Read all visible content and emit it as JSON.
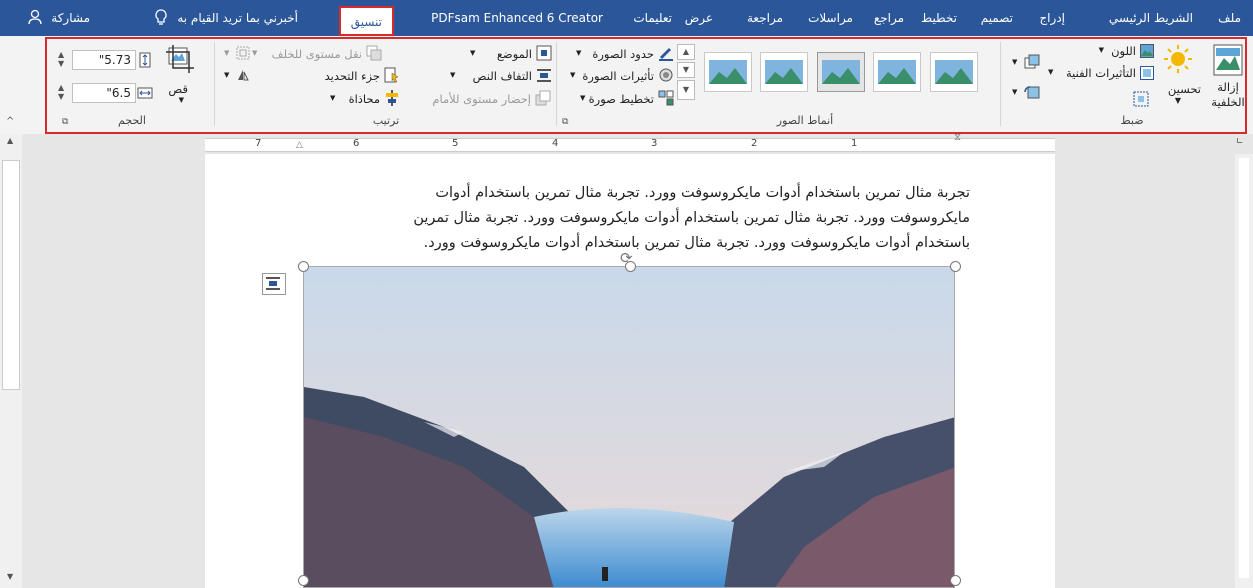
{
  "tabs": {
    "file": "ملف",
    "home": "الشريط الرئيسي",
    "insert": "إدراج",
    "design": "تصميم",
    "layout": "تخطيط",
    "references": "مراجع",
    "mailings": "مراسلات",
    "review": "مراجعة",
    "view": "عرض",
    "help": "تعليمات",
    "pdfsam": "PDFsam Enhanced 6 Creator",
    "format": "تنسيق",
    "tell_me": "أخبرني بما تريد القيام به",
    "share": "مشاركة"
  },
  "adjust": {
    "remove_bg": "إزالة الخلفية",
    "corrections": "تحسين",
    "color": "اللون",
    "artistic": "التأثيرات الفنية",
    "group_label": "ضبط"
  },
  "picture_styles": {
    "border": "حدود الصورة",
    "effects": "تأثيرات الصورة",
    "layout": "تخطيط صورة",
    "group_label": "أنماط الصور"
  },
  "arrange": {
    "position": "الموضع",
    "wrap_text": "التفاف النص",
    "bring_forward": "إحضار مستوى للأمام",
    "send_backward": "نقل مستوى للخلف",
    "selection_pane": "جزء التحديد",
    "align": "محاذاة",
    "group_label": "ترتيب"
  },
  "size": {
    "crop": "قص",
    "height": "\"5.73",
    "width": "\"6.5",
    "group_label": "الحجم"
  },
  "ruler": {
    "numbers": [
      "7",
      "6",
      "5",
      "4",
      "3",
      "2",
      "1"
    ]
  },
  "document": {
    "line1": "تجربة مثال تمرين باستخدام أدوات مايكروسوفت وورد. تجربة مثال تمرين باستخدام أدوات",
    "line2": "مايكروسوفت وورد. تجربة مثال تمرين باستخدام أدوات مايكروسوفت وورد. تجربة مثال تمرين",
    "line3": "باستخدام أدوات مايكروسوفت وورد. تجربة مثال تمرين باستخدام أدوات مايكروسوفت وورد."
  },
  "colors": {
    "accent": "#2b579a",
    "highlight": "#d62b2b"
  }
}
